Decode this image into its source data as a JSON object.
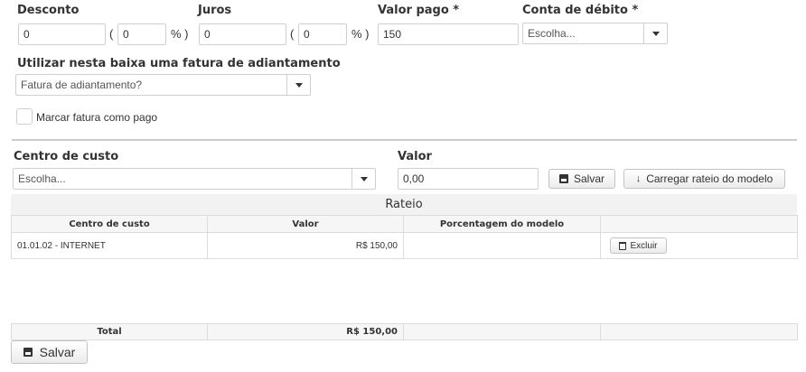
{
  "fields": {
    "desconto": {
      "label": "Desconto",
      "value": "0",
      "percent": "0"
    },
    "juros": {
      "label": "Juros",
      "value": "0",
      "percent": "0"
    },
    "valor_pago": {
      "label": "Valor pago *",
      "value": "150"
    },
    "conta_debito": {
      "label": "Conta de débito *",
      "selected": "Escolha..."
    },
    "paren_open": "(",
    "paren_close": "% )"
  },
  "adiantamento": {
    "label": "Utilizar nesta baixa uma fatura de adiantamento",
    "selected": "Fatura de adiantamento?"
  },
  "marcar_pago": {
    "label": "Marcar fatura como pago",
    "checked": false
  },
  "centro_custo": {
    "label": "Centro de custo",
    "selected": "Escolha..."
  },
  "valor": {
    "label": "Valor",
    "value": "0,00"
  },
  "buttons": {
    "salvar": "Salvar",
    "carregar": "Carregar rateio do modelo",
    "excluir": "Excluir",
    "salvar_bottom": "Salvar"
  },
  "rateio": {
    "title": "Rateio",
    "headers": [
      "Centro de custo",
      "Valor",
      "Porcentagem do modelo",
      ""
    ],
    "rows": [
      {
        "centro": "01.01.02 - INTERNET",
        "valor": "R$ 150,00",
        "porcentagem": ""
      }
    ],
    "total_label": "Total",
    "total_value": "R$ 150,00"
  },
  "icons": [
    "save-icon",
    "download-arrow-icon",
    "trash-icon",
    "chevron-down-icon"
  ]
}
